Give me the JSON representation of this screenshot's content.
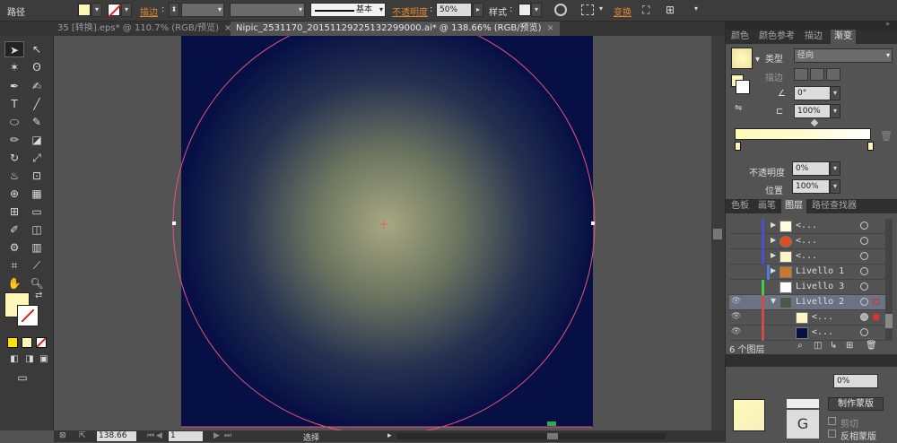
{
  "control_bar": {
    "object_label": "路径",
    "stroke_label": "描边",
    "stroke_style": "基本",
    "opacity_label": "不透明度",
    "opacity_value": "50%",
    "style_label": "样式",
    "transform_label": "变换"
  },
  "doc_tabs": [
    {
      "label": "35 [转换].eps* @ 110.7% (RGB/预览)"
    },
    {
      "label": "Nipic_2531170_20151129225132299000.ai* @ 138.66% (RGB/预览)"
    }
  ],
  "gradient_panel": {
    "tabs": [
      "颜色",
      "颜色参考",
      "描边",
      "渐变"
    ],
    "type_label": "类型",
    "type_value": "径向",
    "stroke_label": "描边",
    "angle_value": "0°",
    "aspect_value": "100%",
    "opacity_label": "不透明度",
    "opacity_value": "0%",
    "location_label": "位置",
    "location_value": "100%"
  },
  "layers_panel": {
    "tabs": [
      "色板",
      "画笔",
      "图层",
      "路径查找器"
    ],
    "rows": [
      {
        "name": "<...",
        "bar": "#4a4fd0",
        "thumb": "#fffbdc",
        "eye": false
      },
      {
        "name": "<...",
        "bar": "#4a4fd0",
        "thumb": "#e04a1f",
        "eye": false
      },
      {
        "name": "<...",
        "bar": "#4a4fd0",
        "thumb": "#fff6c8",
        "eye": false
      },
      {
        "name": "Livello 1",
        "bar": "#4a7fe0",
        "thumb": "#c8772e",
        "eye": false
      },
      {
        "name": "Livello 3",
        "bar": "#3fd04a",
        "thumb": "#ffffff",
        "eye": false
      },
      {
        "name": "Livello 2",
        "bar": "#d04a4a",
        "thumb": "#4a5a4a",
        "eye": true
      },
      {
        "name": "<...",
        "bar": "#d04a4a",
        "thumb": "#fff6c8",
        "eye": true
      },
      {
        "name": "<...",
        "bar": "#d04a4a",
        "thumb": "#061045",
        "eye": true
      }
    ],
    "count_label": "6 个图层"
  },
  "transparency_panel": {
    "opacity_value": "0%",
    "make_mask_label": "制作蒙版",
    "clip_label": "剪切",
    "invert_label": "反相蒙版"
  },
  "status_bar": {
    "zoom": "138.66",
    "page": "1",
    "tool_label": "选择"
  },
  "colors": {
    "artboard": "#061045",
    "glow": "#a7a882",
    "path_stroke": "#e8557a",
    "gradient_start": "#fffbbc"
  }
}
